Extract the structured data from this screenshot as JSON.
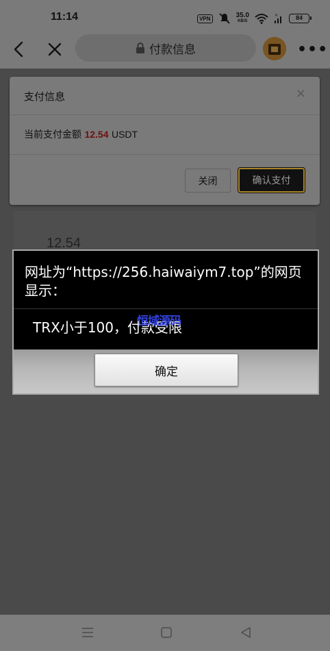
{
  "status_bar": {
    "time": "11:14",
    "vpn_label": "VPN",
    "network_speed": "35.0",
    "network_speed_unit": "KB/S",
    "battery": "84"
  },
  "browser": {
    "page_title": "付款信息",
    "back_icon": "chevron-left-icon",
    "close_icon": "close-icon",
    "more_icon": "more-dots-icon",
    "more_label": "•••"
  },
  "payment_dialog": {
    "title": "支付信息",
    "close_glyph": "×",
    "amount_prefix": "当前支付金额",
    "amount": "12.54",
    "currency": "USDT",
    "close_button": "关闭",
    "confirm_button": "确认支付"
  },
  "background_card": {
    "amount": "12.54"
  },
  "alert": {
    "title": "网址为“https://256.haiwaiym7.top”的网页显示：",
    "message": "TRX小于100，付款受限",
    "watermark": "恒域源码",
    "ok_button": "确定"
  },
  "colors": {
    "amount_red": "#6e0f0f",
    "confirm_border_gold": "#a8842a",
    "watermark_blue": "#3a4cff"
  }
}
